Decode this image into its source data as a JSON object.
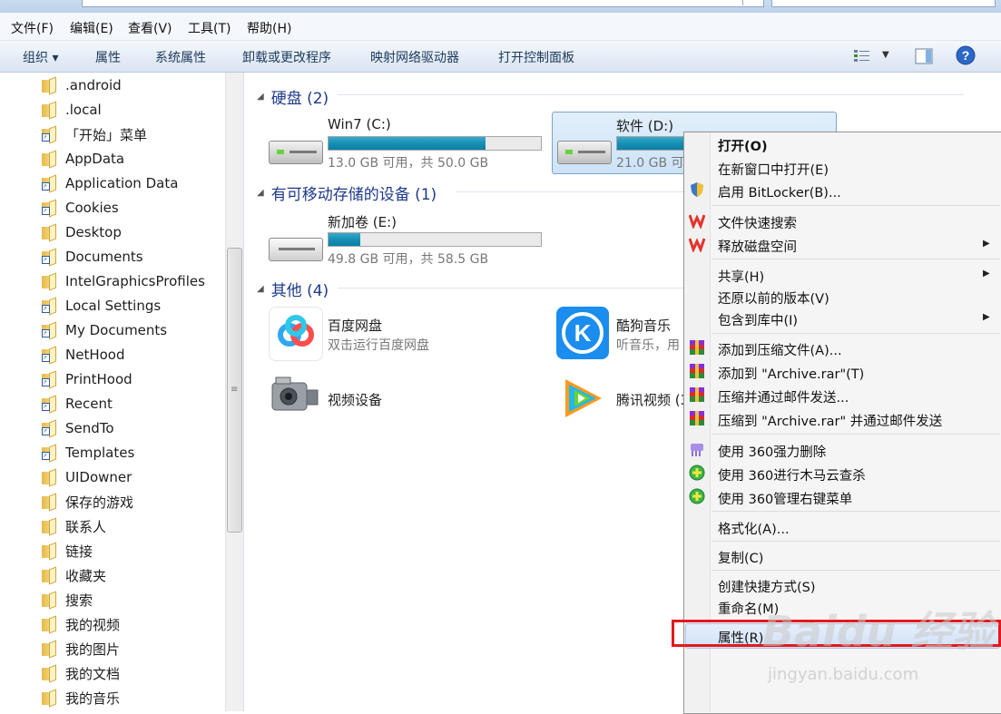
{
  "menubar": [
    "文件(F)",
    "编辑(E)",
    "查看(V)",
    "工具(T)",
    "帮助(H)"
  ],
  "toolbar": {
    "organize": "组织 ▾",
    "properties": "属性",
    "system_properties": "系统属性",
    "uninstall": "卸载或更改程序",
    "map_drive": "映射网络驱动器",
    "control_panel": "打开控制面板"
  },
  "nav": [
    {
      "label": ".android",
      "icon": "folder-icon"
    },
    {
      "label": ".local",
      "icon": "folder-icon"
    },
    {
      "label": "「开始」菜单",
      "icon": "shortcut-folder-icon"
    },
    {
      "label": "AppData",
      "icon": "folder-icon"
    },
    {
      "label": "Application Data",
      "icon": "shortcut-folder-icon"
    },
    {
      "label": "Cookies",
      "icon": "shortcut-folder-icon"
    },
    {
      "label": "Desktop",
      "icon": "folder-icon"
    },
    {
      "label": "Documents",
      "icon": "shortcut-folder-icon"
    },
    {
      "label": "IntelGraphicsProfiles",
      "icon": "folder-icon"
    },
    {
      "label": "Local Settings",
      "icon": "shortcut-folder-icon"
    },
    {
      "label": "My Documents",
      "icon": "shortcut-folder-icon"
    },
    {
      "label": "NetHood",
      "icon": "shortcut-folder-icon"
    },
    {
      "label": "PrintHood",
      "icon": "shortcut-folder-icon"
    },
    {
      "label": "Recent",
      "icon": "recent-icon"
    },
    {
      "label": "SendTo",
      "icon": "shortcut-folder-icon"
    },
    {
      "label": "Templates",
      "icon": "shortcut-folder-icon"
    },
    {
      "label": "UIDowner",
      "icon": "folder-icon"
    },
    {
      "label": "保存的游戏",
      "icon": "games-folder-icon"
    },
    {
      "label": "联系人",
      "icon": "contacts-folder-icon"
    },
    {
      "label": "链接",
      "icon": "links-folder-icon"
    },
    {
      "label": "收藏夹",
      "icon": "favorites-folder-icon"
    },
    {
      "label": "搜索",
      "icon": "search-folder-icon"
    },
    {
      "label": "我的视频",
      "icon": "videos-folder-icon"
    },
    {
      "label": "我的图片",
      "icon": "pictures-folder-icon"
    },
    {
      "label": "我的文档",
      "icon": "documents-folder-icon"
    },
    {
      "label": "我的音乐",
      "icon": "music-folder-icon"
    }
  ],
  "groups": {
    "hdd": "硬盘 (2)",
    "removable": "有可移动存储的设备 (1)",
    "other": "其他 (4)"
  },
  "drives": [
    {
      "name": "Win7 (C:)",
      "free": "13.0 GB 可用，共 50.0 GB",
      "used_pct": 74
    },
    {
      "name": "软件 (D:)",
      "free": "21.0 GB 可",
      "used_pct": 58
    },
    {
      "name": "新加卷 (E:)",
      "free": "49.8 GB 可用，共 58.5 GB",
      "used_pct": 15
    }
  ],
  "others": [
    {
      "name": "百度网盘",
      "desc": "双击运行百度网盘"
    },
    {
      "name": "酷狗音乐",
      "desc": "听音乐，用"
    },
    {
      "name": "视频设备",
      "desc": ""
    },
    {
      "name": "腾讯视频 (3",
      "desc": ""
    }
  ],
  "context_menu": {
    "open": "打开(O)",
    "open_new_window": "在新窗口中打开(E)",
    "bitlocker": "启用 BitLocker(B)...",
    "wps_search": "文件快速搜索",
    "wps_free_space": "释放磁盘空间",
    "share": "共享(H)",
    "restore": "还原以前的版本(V)",
    "include_library": "包含到库中(I)",
    "add_archive": "添加到压缩文件(A)...",
    "add_to_rar": "添加到 \"Archive.rar\"(T)",
    "compress_email": "压缩并通过邮件发送...",
    "compress_rar_email": "压缩到 \"Archive.rar\" 并通过邮件发送",
    "shred_360": "使用 360强力删除",
    "scan_360": "使用 360进行木马云查杀",
    "manage_360": "使用 360管理右键菜单",
    "format": "格式化(A)...",
    "copy": "复制(C)",
    "create_shortcut": "创建快捷方式(S)",
    "rename": "重命名(M)",
    "properties": "属性(R)"
  },
  "watermark": {
    "brand": "Baidu 经验",
    "url": "jingyan.baidu.com"
  },
  "colors": {
    "accent": "#1e3a8a",
    "highlight_box": "#e4181c",
    "bar_fill": "#1690b5"
  }
}
